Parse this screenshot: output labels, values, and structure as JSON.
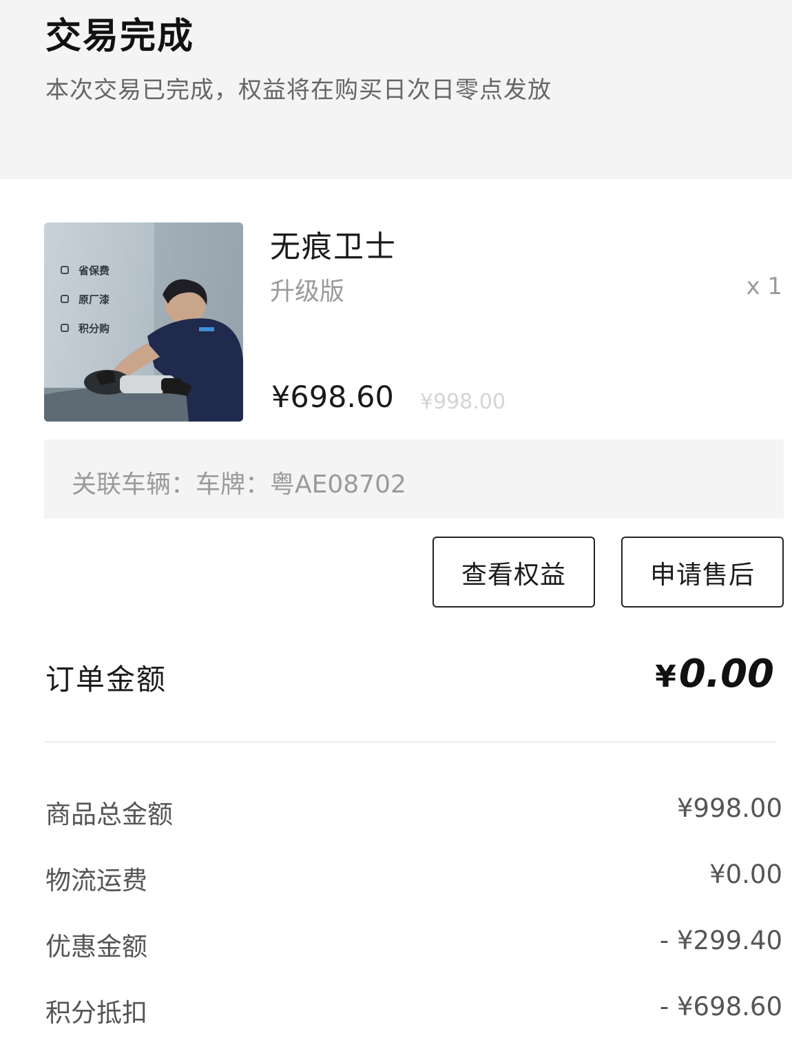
{
  "header": {
    "title": "交易完成",
    "subtitle": "本次交易已完成，权益将在购买日次日零点发放"
  },
  "product": {
    "image_badges": [
      "省保费",
      "原厂漆",
      "积分购"
    ],
    "name": "无痕卫士",
    "variant": "升级版",
    "quantity": "x 1",
    "price": "¥698.60",
    "original_price": "¥998.00",
    "vehicle": "关联车辆：车牌：粤AE08702"
  },
  "actions": {
    "view_benefits": "查看权益",
    "apply_aftersale": "申请售后"
  },
  "order": {
    "label": "订单金额",
    "currency": "¥",
    "amount": "0.00"
  },
  "summary": [
    {
      "label": "商品总金额",
      "value": "¥998.00"
    },
    {
      "label": "物流运费",
      "value": "¥0.00"
    },
    {
      "label": "优惠金额",
      "value": "- ¥299.40"
    },
    {
      "label": "积分抵扣",
      "value": "- ¥698.60"
    }
  ]
}
